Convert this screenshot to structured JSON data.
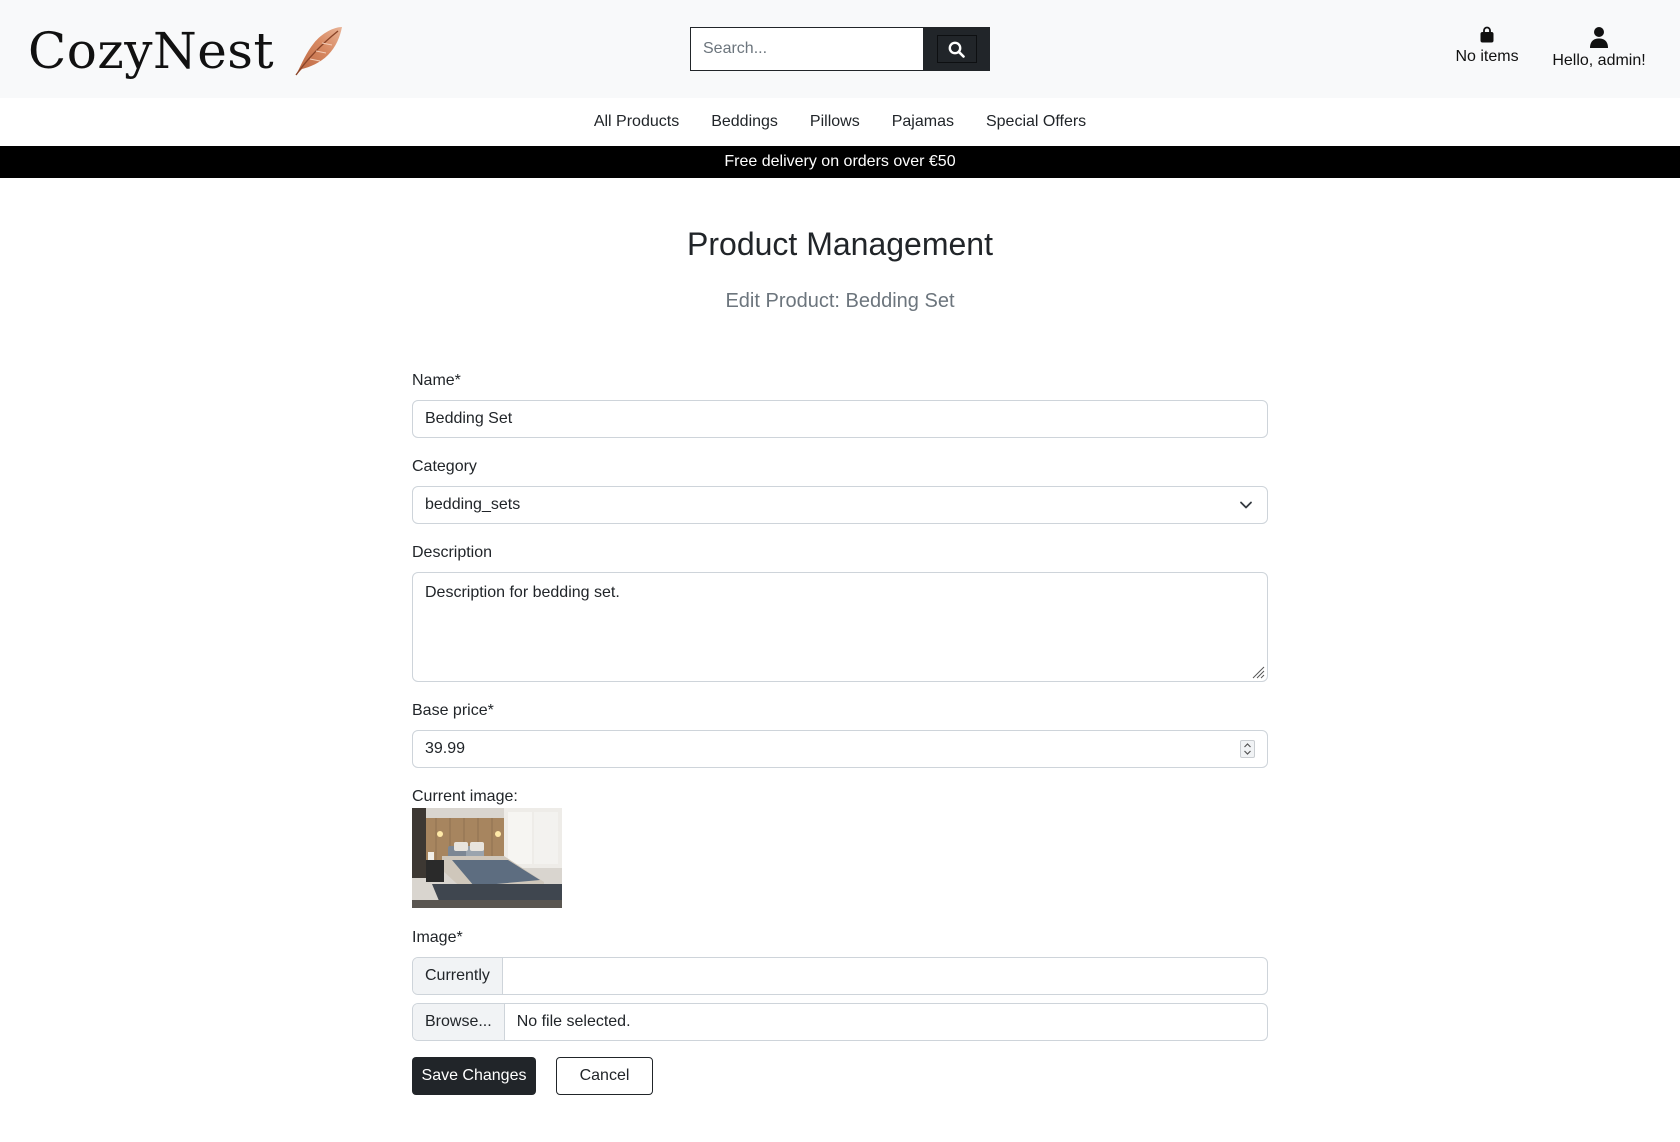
{
  "header": {
    "brand": "CozyNest",
    "search_placeholder": "Search...",
    "bag_label": "No items",
    "account_label": "Hello, admin!"
  },
  "nav": {
    "items": [
      "All Products",
      "Beddings",
      "Pillows",
      "Pajamas",
      "Special Offers"
    ]
  },
  "banner": "Free delivery on orders over €50",
  "page": {
    "title": "Product Management",
    "subtitle": "Edit Product: Bedding Set"
  },
  "form": {
    "name_label": "Name*",
    "name_value": "Bedding Set",
    "category_label": "Category",
    "category_value": "bedding_sets",
    "description_label": "Description",
    "description_value": "Description for bedding set.",
    "price_label": "Base price*",
    "price_value": "39.99",
    "current_image_label": "Current image:",
    "image_label": "Image*",
    "currently_label": "Currently",
    "browse_label": "Browse...",
    "no_file_label": "No file selected.",
    "save_label": "Save Changes",
    "cancel_label": "Cancel"
  },
  "colors": {
    "dark": "#212529",
    "header_bg": "#f8f9fa",
    "banner_bg": "#000000",
    "feather": "#c8744f"
  }
}
